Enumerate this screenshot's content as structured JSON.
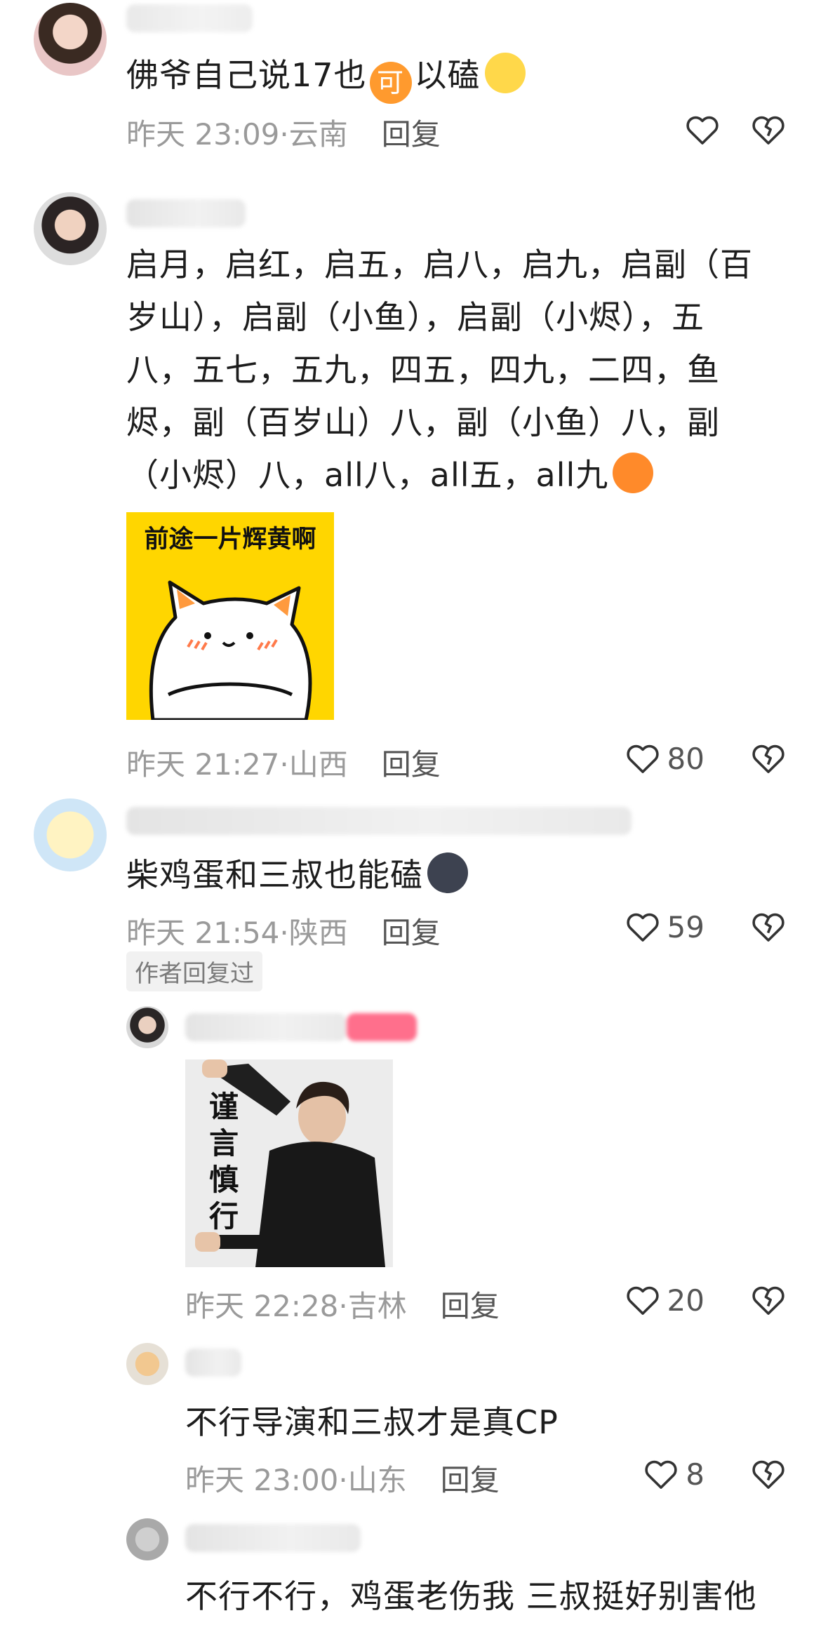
{
  "comments": [
    {
      "text_a": "佛爷自己说17也",
      "keyword": "可",
      "text_b": "以磕",
      "time": "昨天 23:09·云南",
      "reply": "回复"
    },
    {
      "lines": [
        "启月，启红，启五，启八，启九，启副（百",
        "岁山），启副（小鱼），启副（小烬），五",
        "八，五七，五九，四五，四九，二四，鱼",
        "烬，副（百岁山）八，副（小鱼）八，副",
        "（小烬）八，all八，all五，all九"
      ],
      "sticker_text": "前途一片辉黄啊",
      "time": "昨天 21:27·山西",
      "reply": "回复",
      "likes": "80"
    },
    {
      "text": "柴鸡蛋和三叔也能磕",
      "time": "昨天 21:54·陕西",
      "reply": "回复",
      "likes": "59",
      "badge": "作者回复过"
    }
  ],
  "replies": [
    {
      "sticker_text": [
        "谨",
        "言",
        "慎",
        "行"
      ],
      "time": "昨天 22:28·吉林",
      "reply": "回复",
      "likes": "20"
    },
    {
      "text": "不行导演和三叔才是真CP",
      "time": "昨天 23:00·山东",
      "reply": "回复",
      "likes": "8"
    },
    {
      "text": "不行不行，鸡蛋老伤我 三叔挺好别害他"
    }
  ],
  "colors": {
    "sticker_yellow": "#ffd600",
    "keyword_orange": "#ff9a2e",
    "meta_gray": "#9a9a9a"
  }
}
